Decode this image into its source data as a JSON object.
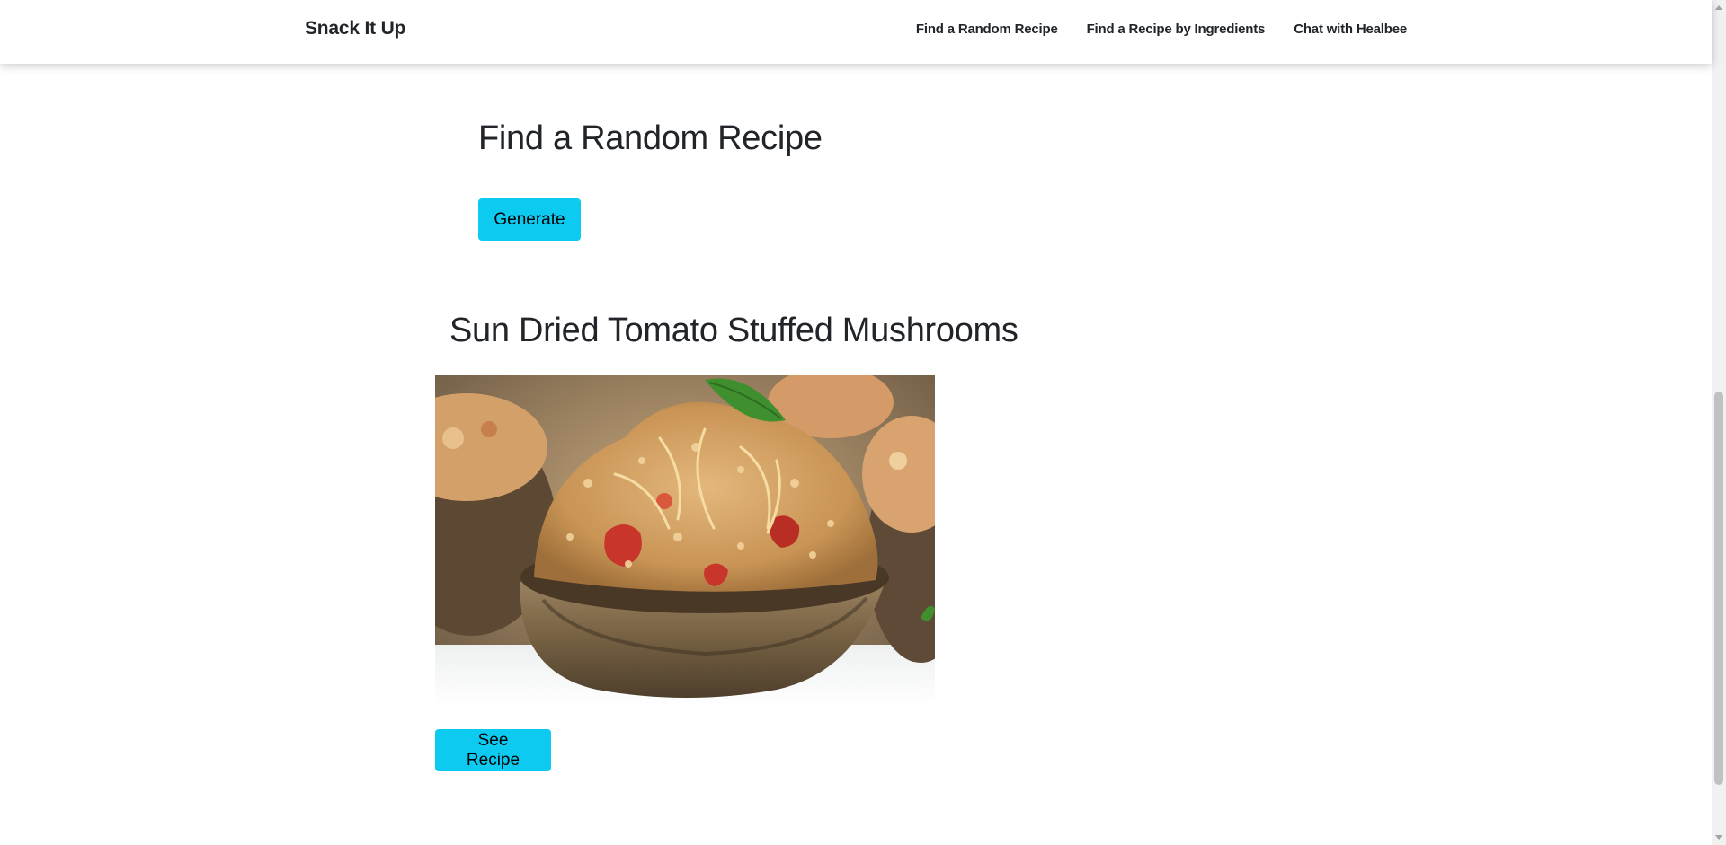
{
  "navbar": {
    "brand": "Snack It Up",
    "links": [
      {
        "label": "Find a Random Recipe"
      },
      {
        "label": "Find a Recipe by Ingredients"
      },
      {
        "label": "Chat with Healbee"
      }
    ]
  },
  "random_recipe": {
    "title": "Find a Random Recipe",
    "generate_label": "Generate"
  },
  "result": {
    "recipe_title": "Sun Dried Tomato Stuffed Mushrooms",
    "image_alt": "Sun Dried Tomato Stuffed Mushrooms",
    "see_recipe_label": "See Recipe"
  },
  "colors": {
    "button": "#0dcaf0",
    "text": "#212529"
  }
}
